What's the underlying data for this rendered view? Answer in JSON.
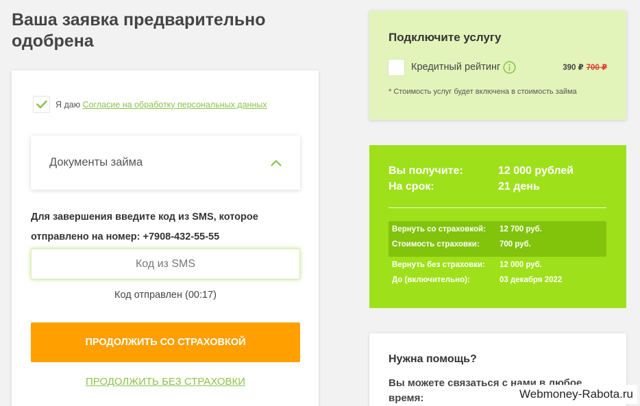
{
  "page": {
    "title": "Ваша заявка предварительно одобрена"
  },
  "consent": {
    "prefix": "Я даю",
    "link_text": "Согласие на обработку персональных данных",
    "checked": true
  },
  "documents": {
    "title": "Документы займа",
    "expanded": true
  },
  "sms": {
    "instruction": "Для завершения введите код из SMS, которое отправлено на номер: +7908-432-55-55",
    "placeholder": "Код из SMS",
    "value": "",
    "status": "Код отправлен (00:17)"
  },
  "actions": {
    "continue_with_insurance": "ПРОДОЛЖИТЬ СО СТРАХОВКОЙ",
    "continue_without_insurance": "ПРОДОЛЖИТЬ БЕЗ СТРАХОВКИ"
  },
  "service": {
    "title": "Подключите услугу",
    "name": "Кредитный рейтинг",
    "checked": false,
    "price": "390 ₽",
    "old_price": "700 ₽",
    "note": "* Стоимость услуг будет включена в стоимость займа"
  },
  "summary": {
    "receive_label": "Вы получите:",
    "receive_value": "12 000 рублей",
    "term_label": "На срок:",
    "term_value": "21 день",
    "insured": {
      "repay_label": "Вернуть со страховкой:",
      "repay_value": "12 700 руб.",
      "cost_label": "Стоимость страховки:",
      "cost_value": "700 руб."
    },
    "uninsured": {
      "repay_label": "Вернуть без страховки:",
      "repay_value": "12 000 руб.",
      "until_label": "До (включительно):",
      "until_value": "03 декабря 2022"
    }
  },
  "help": {
    "title": "Нужна помощь?",
    "text": "Вы можете связаться с нами в любое время:"
  },
  "watermark": "Webmoney-Rabota.ru",
  "colors": {
    "accent_green": "#8bc34a",
    "summary_green": "#9ee01a",
    "service_bg": "#e2f4ba",
    "button_orange": "#ff9f00",
    "old_price_red": "#e53935"
  }
}
